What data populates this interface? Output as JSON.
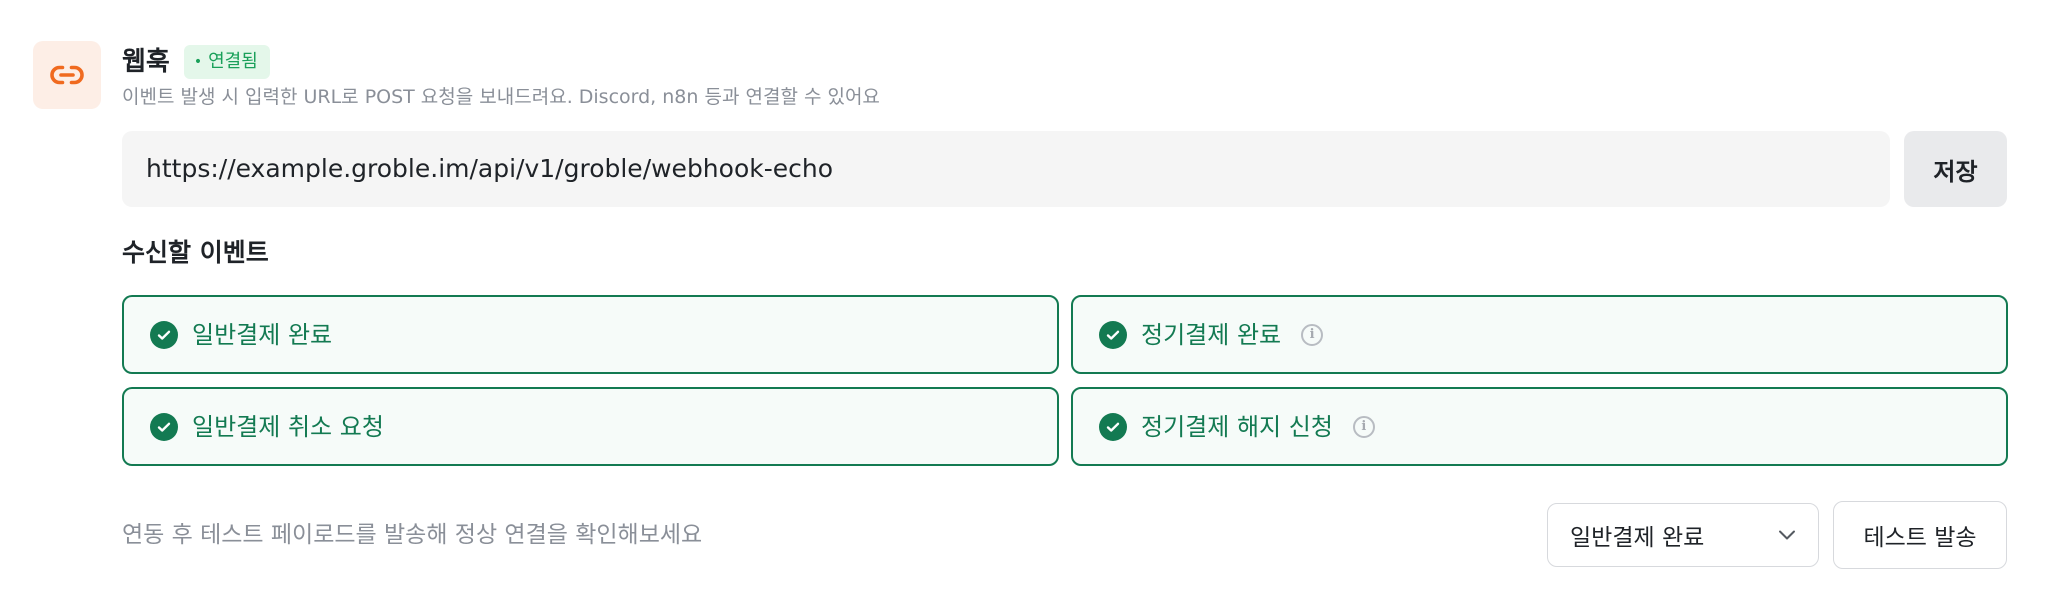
{
  "webhook": {
    "title": "웹훅",
    "status_badge": "연결됨",
    "description": "이벤트 발생 시 입력한 URL로 POST 요청을 보내드려요. Discord, n8n 등과 연결할 수 있어요",
    "url_value": "https://example.groble.im/api/v1/groble/webhook-echo",
    "save_label": "저장",
    "icon": "link-icon",
    "accent_color": "#f06a1f"
  },
  "events": {
    "title": "수신할 이벤트",
    "items": [
      {
        "label": "일반결제 완료",
        "checked": true,
        "has_info": false
      },
      {
        "label": "정기결제 완료",
        "checked": true,
        "has_info": true
      },
      {
        "label": "일반결제 취소 요청",
        "checked": true,
        "has_info": false
      },
      {
        "label": "정기결제 해지 신청",
        "checked": true,
        "has_info": true
      }
    ],
    "checked_color": "#137a52"
  },
  "test": {
    "hint": "연동 후 테스트 페이로드를 발송해 정상 연결을 확인해보세요",
    "selected_event": "일반결제 완료",
    "send_label": "테스트 발송"
  }
}
